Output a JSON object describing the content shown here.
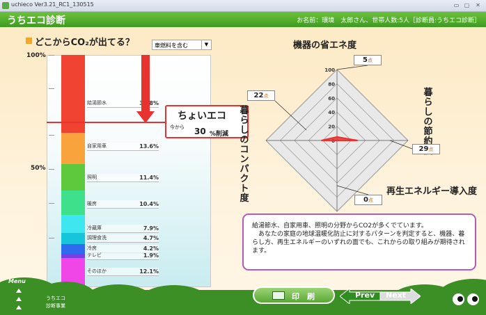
{
  "window": {
    "title": "uchieco Ver3.21_RC1_130515",
    "buttons": [
      "▭",
      "▢",
      "✕"
    ]
  },
  "header": {
    "app_title": "うちエコ診断",
    "user_info": "お名前：環境　太郎さん、世帯人数:5人［診断員:うちエコ診断］"
  },
  "chart_section": {
    "title": "どこからCO₂が出てる？",
    "fuel_select": "車燃料を含む",
    "axis_top": "100%",
    "axis_mid": "50%"
  },
  "chart_data": {
    "type": "bar",
    "stacked": true,
    "title": "どこからCO₂が出てる？",
    "categories": [
      "給湯節水",
      "自家用車",
      "照明",
      "暖房",
      "冷蔵庫",
      "調理食洗",
      "冷房",
      "テレビ",
      "そのほか"
    ],
    "values": [
      33.8,
      13.6,
      11.4,
      10.4,
      7.9,
      4.7,
      4.2,
      1.9,
      12.1
    ],
    "labels": [
      "33.8%",
      "13.6%",
      "11.4%",
      "10.4%",
      "7.9%",
      "4.7%",
      "4.2%",
      "1.9%",
      "12.1%"
    ],
    "colors": [
      "#f04332",
      "#f9a33c",
      "#5ec93c",
      "#3fe08c",
      "#3ee6f0",
      "#16c4dc",
      "#2f6bf0",
      "#7a3fe0",
      "#f046e8"
    ],
    "ylim": [
      0,
      100
    ],
    "ytick_labels": [
      "100%",
      "50%"
    ]
  },
  "eco_callout": {
    "title": "ちょいエコ",
    "from": "今から",
    "value": "30",
    "unit": "%削減"
  },
  "radar": {
    "axes": [
      {
        "label": "機器の省エネ度",
        "score": "5"
      },
      {
        "label": "暮らしの節約度",
        "score": "29"
      },
      {
        "label": "再生エネルギー導入度",
        "score": "0"
      },
      {
        "label": "暮らしのコンパクト度",
        "score": "22"
      }
    ],
    "score_unit": "点",
    "scale_labels": [
      "100",
      "80",
      "60",
      "40",
      "20",
      "0"
    ],
    "scores": [
      5,
      29,
      0,
      22
    ],
    "max": 100,
    "polygon_color": "#e8322f",
    "grid_color": "#9c9c9c"
  },
  "comment": {
    "text": "給湯節水、自家用車、照明の分野からCO2が多くでています。\n　あなたの家庭の地球温暖化防止に対するパターンを判定すると、機器、暮らし方、再生エネルギーのいずれの面でも、これからの取り組みが期待されます。"
  },
  "footer": {
    "menu_label": "Menu",
    "brand_line1": "うちエコ",
    "brand_line2": "診断事業",
    "print_label": "印　刷",
    "prev_label": "Prev",
    "next_label": "Next"
  },
  "colors": {
    "green_bar": "#4caf2e",
    "red_accent": "#e8322f",
    "comment_border": "#b45cb4",
    "background": "#fef3dd"
  }
}
